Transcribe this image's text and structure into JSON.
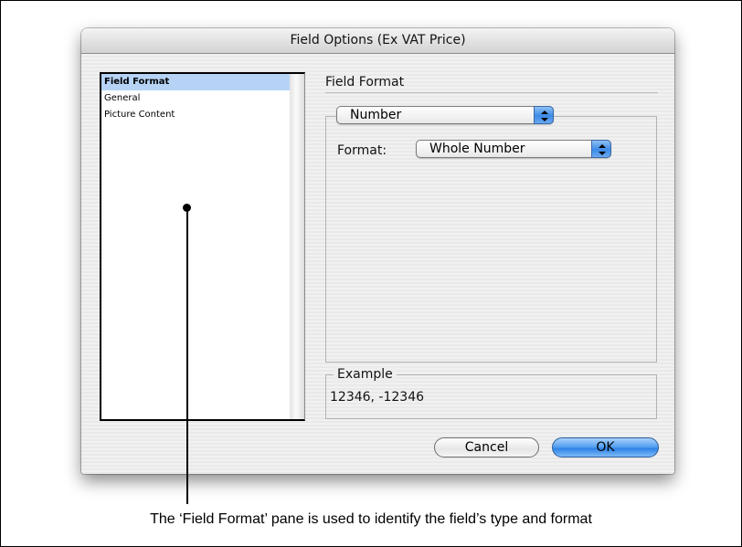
{
  "window": {
    "title": "Field Options (Ex VAT Price)"
  },
  "sidebar": {
    "items": [
      {
        "label": "Field Format",
        "selected": true
      },
      {
        "label": "General",
        "selected": false
      },
      {
        "label": "Picture Content",
        "selected": false
      }
    ]
  },
  "main": {
    "section_title": "Field Format",
    "type_popup": {
      "value": "Number",
      "icon": "popup-arrows-icon"
    },
    "format_label": "Format:",
    "format_popup": {
      "value": "Whole Number",
      "icon": "popup-arrows-icon"
    },
    "example": {
      "label": "Example",
      "value": "12346, -12346"
    }
  },
  "buttons": {
    "cancel": "Cancel",
    "ok": "OK"
  },
  "annotation": {
    "caption": "The ‘Field Format’ pane is used to identify the field’s type and format"
  },
  "colors": {
    "selection": "#b6d3f5",
    "default_button": "#4f9cf0"
  }
}
